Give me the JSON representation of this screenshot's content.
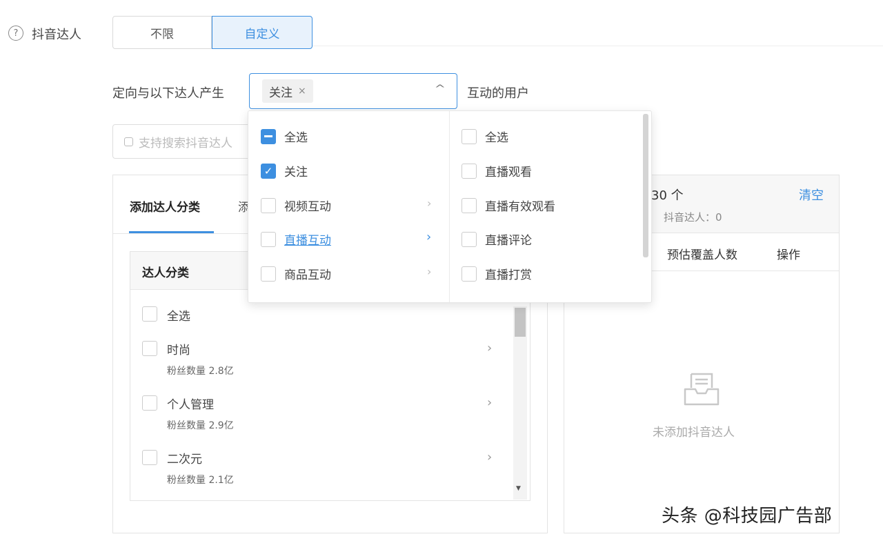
{
  "header": {
    "label": "抖音达人",
    "help_icon": "question-circle-icon",
    "segments": [
      "不限",
      "自定义"
    ]
  },
  "targeting": {
    "label": "定向与以下达人产生",
    "suffix": "互动的用户",
    "selected_tag": "关注",
    "tag_close": "×",
    "caret": "^"
  },
  "search": {
    "placeholder": "支持搜索抖音达人"
  },
  "left_panel": {
    "tab_active": "添加达人分类",
    "tab_other": "添",
    "category_title": "达人分类",
    "select_all": "全选",
    "categories": [
      {
        "name": "时尚",
        "fans": "粉丝数量 2.8亿"
      },
      {
        "name": "个人管理",
        "fans": "粉丝数量 2.9亿"
      },
      {
        "name": "二次元",
        "fans": "粉丝数量 2.1亿"
      }
    ]
  },
  "right_panel": {
    "count": "30 个",
    "clear": "清空",
    "sub": "抖音达人：0",
    "col_estimate": "预估覆盖人数",
    "col_action": "操作",
    "empty_text": "未添加抖音达人",
    "empty_icon": "inbox-icon"
  },
  "dropdown": {
    "left": [
      {
        "label": "全选",
        "state": "partial"
      },
      {
        "label": "关注",
        "state": "checked"
      },
      {
        "label": "视频互动",
        "state": "unchecked"
      },
      {
        "label": "直播互动",
        "state": "unchecked"
      },
      {
        "label": "商品互动",
        "state": "unchecked"
      }
    ],
    "right": [
      "全选",
      "直播观看",
      "直播有效观看",
      "直播评论",
      "直播打赏"
    ]
  },
  "watermark": "头条 @科技园广告部",
  "colors": {
    "accent": "#3d8fe0",
    "border": "#e3e3e3"
  }
}
